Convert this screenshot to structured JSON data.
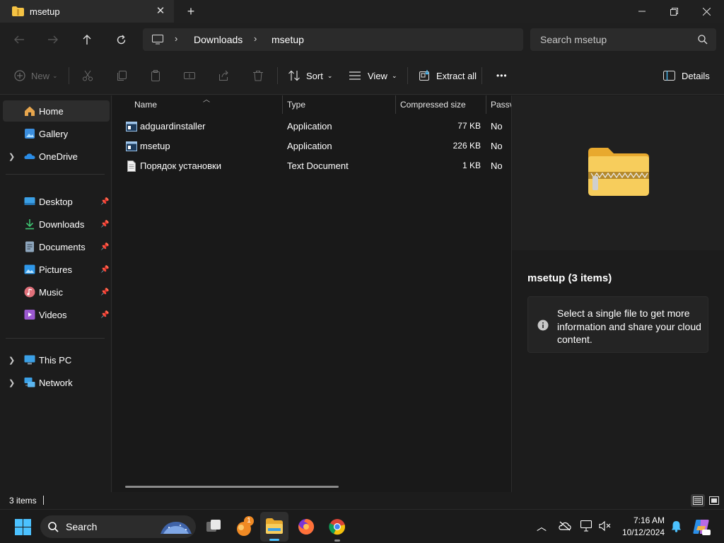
{
  "window": {
    "tab_title": "msetup",
    "tab_close": "✕",
    "new_tab": "+",
    "minimize": "—",
    "maximize": "❐",
    "close": "✕"
  },
  "address": {
    "breadcrumbs": [
      "Downloads",
      "msetup"
    ],
    "search_placeholder": "Search msetup"
  },
  "commands": {
    "new_label": "New",
    "sort_label": "Sort",
    "view_label": "View",
    "extract_label": "Extract all",
    "more_label": "•••",
    "details_label": "Details"
  },
  "sidebar": {
    "items": [
      {
        "label": "Home",
        "icon": "home-icon",
        "selected": true
      },
      {
        "label": "Gallery",
        "icon": "gallery-icon"
      },
      {
        "label": "OneDrive",
        "icon": "onedrive-icon"
      },
      {
        "label": "Desktop",
        "icon": "desktop-icon"
      },
      {
        "label": "Downloads",
        "icon": "downloads-icon"
      },
      {
        "label": "Documents",
        "icon": "documents-icon"
      },
      {
        "label": "Pictures",
        "icon": "pictures-icon"
      },
      {
        "label": "Music",
        "icon": "music-icon"
      },
      {
        "label": "Videos",
        "icon": "videos-icon"
      },
      {
        "label": "This PC",
        "icon": "this-pc-icon"
      },
      {
        "label": "Network",
        "icon": "network-icon"
      }
    ]
  },
  "filelist": {
    "columns": [
      "Name",
      "Type",
      "Compressed size",
      "Passv"
    ],
    "rows": [
      {
        "name": "adguardinstaller",
        "type": "Application",
        "size": "77 KB",
        "password": "No"
      },
      {
        "name": "msetup",
        "type": "Application",
        "size": "226 KB",
        "password": "No"
      },
      {
        "name": "Порядок установки",
        "type": "Text Document",
        "size": "1 KB",
        "password": "No"
      }
    ]
  },
  "preview": {
    "title": "msetup (3 items)",
    "info": "Select a single file to get more information and share your cloud content."
  },
  "status": {
    "count": "3 items"
  },
  "taskbar": {
    "search_label": "Search",
    "badge": "1",
    "time": "7:16 AM",
    "date": "10/12/2024"
  },
  "colors": {
    "accent": "#4cc2ff",
    "folder": "#f5c344"
  }
}
